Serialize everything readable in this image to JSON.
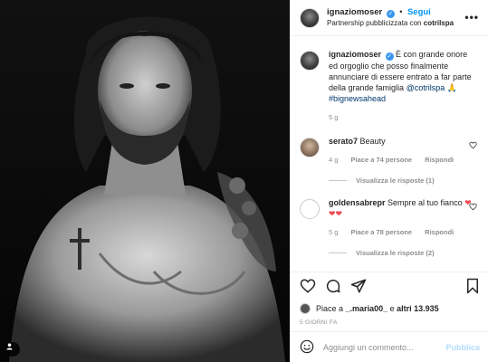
{
  "post": {
    "username": "ignaziomoser",
    "follow_label": "Segui",
    "dot": "•",
    "partnership_prefix": "Partnership pubblicizzata con",
    "partnership_brand": "cotrilspa",
    "more_label": "•••"
  },
  "caption": {
    "username": "ignaziomoser",
    "text": "È con grande onore ed orgoglio che posso finalmente annunciare di essere entrato a far parte della grande famiglia",
    "mention": "@cotrilspa",
    "emoji": "🙏",
    "hashtag": "#bignewsahead",
    "age": "5 g"
  },
  "comments": [
    {
      "username": "serato7",
      "text": "Beauty",
      "age": "4 g",
      "likes": "Piace a 74 persone",
      "reply_label": "Rispondi",
      "view_replies": "Visualizza le risposte (1)"
    },
    {
      "username": "goldensabrepr",
      "text": "Sempre al tuo fianco",
      "hearts": "❤❤❤",
      "age": "5 g",
      "likes": "Piace a 78 persone",
      "reply_label": "Rispondi",
      "view_replies": "Visualizza le risposte (2)"
    }
  ],
  "likes_line": {
    "prefix": "Piace a",
    "user": "_.maria00_",
    "middle": "e",
    "others": "altri 13.935"
  },
  "post_age": "5 GIORNI FA",
  "add_comment": {
    "placeholder": "Aggiungi un commento...",
    "publish_label": "Pubblica"
  },
  "icons": {
    "verified": "verified-badge-icon",
    "like": "heart-icon",
    "comment": "comment-icon",
    "share": "share-icon",
    "save": "bookmark-icon",
    "emoji": "emoji-icon",
    "tag": "user-tag-icon"
  },
  "colors": {
    "accent": "#0095f6",
    "verified": "#3897f0",
    "muted": "#8e8e8e",
    "heart": "#ed4956",
    "publish_disabled": "#b2dffc"
  }
}
